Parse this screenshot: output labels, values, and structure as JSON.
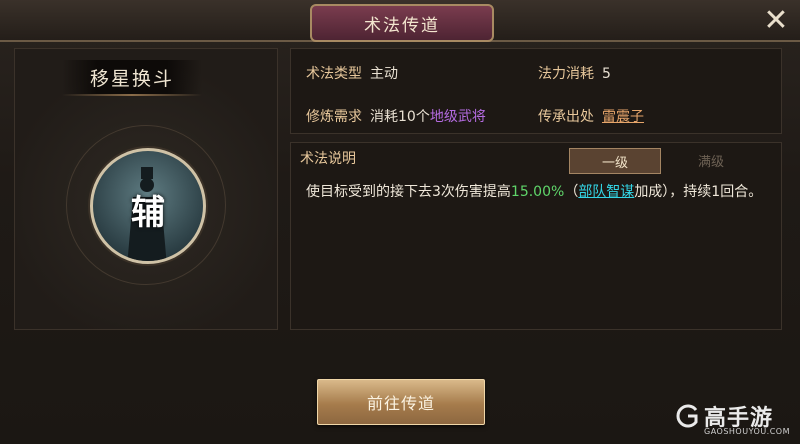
{
  "dialog": {
    "title": "术法传道"
  },
  "skill": {
    "name": "移星换斗",
    "role_char": "辅"
  },
  "info": {
    "type_label": "术法类型",
    "type_value": "主动",
    "cost_label": "法力消耗",
    "cost_value": "5",
    "req_label": "修炼需求",
    "req_prefix": "消耗10个",
    "req_item": "地级武将",
    "source_label": "传承出处",
    "source_value": "雷震子"
  },
  "description": {
    "title": "术法说明",
    "level_tabs": [
      "一级",
      "满级"
    ],
    "text_1": "使目标受到的接下去3次伤害提高",
    "text_pct": "15.00%",
    "text_2": "（",
    "text_link": "部队智谋",
    "text_3": "加成），持续1回合。"
  },
  "actions": {
    "go_label": "前往传道"
  },
  "watermark": {
    "main": "高手游",
    "sub": "GAOSHOUYOU.COM"
  },
  "colors": {
    "purple": "#b46be0",
    "green": "#5fd56a",
    "cyan": "#33d6e6"
  }
}
